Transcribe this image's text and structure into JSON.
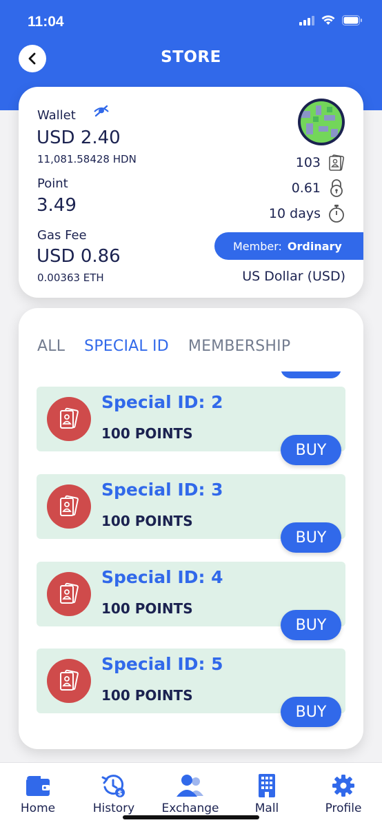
{
  "status_bar": {
    "time": "11:04"
  },
  "header": {
    "title": "STORE"
  },
  "wallet": {
    "wallet_label": "Wallet",
    "wallet_usd": "USD 2.40",
    "wallet_hdn": "11,081.58428 HDN",
    "point_label": "Point",
    "point_value": "3.49",
    "gas_label": "Gas Fee",
    "gas_usd": "USD 0.86",
    "gas_eth": "0.00363 ETH",
    "stats": [
      {
        "value": "103",
        "icon": "id-cards-icon"
      },
      {
        "value": "0.61",
        "icon": "lock-icon"
      },
      {
        "value": "10 days",
        "icon": "stopwatch-icon"
      }
    ],
    "member_label": "Member:",
    "member_level": "Ordinary",
    "currency": "US Dollar (USD)"
  },
  "store": {
    "tabs": [
      {
        "label": "ALL",
        "active": false
      },
      {
        "label": "SPECIAL ID",
        "active": true
      },
      {
        "label": "MEMBERSHIP",
        "active": false
      }
    ],
    "items": [
      {
        "title": "Special ID: 2",
        "points": "100 POINTS",
        "buy_label": "BUY"
      },
      {
        "title": "Special ID: 3",
        "points": "100 POINTS",
        "buy_label": "BUY"
      },
      {
        "title": "Special ID: 4",
        "points": "100 POINTS",
        "buy_label": "BUY"
      },
      {
        "title": "Special ID: 5",
        "points": "100 POINTS",
        "buy_label": "BUY"
      }
    ]
  },
  "tabbar": {
    "items": [
      {
        "label": "Home",
        "icon": "wallet-icon"
      },
      {
        "label": "History",
        "icon": "history-icon"
      },
      {
        "label": "Exchange",
        "icon": "users-icon"
      },
      {
        "label": "Mall",
        "icon": "building-icon"
      },
      {
        "label": "Profile",
        "icon": "gear-icon"
      }
    ]
  },
  "colors": {
    "primary": "#3169ea",
    "item_bg": "#dff1e8",
    "icon_red": "#cf4b4b",
    "text_dark": "#1b2250"
  }
}
